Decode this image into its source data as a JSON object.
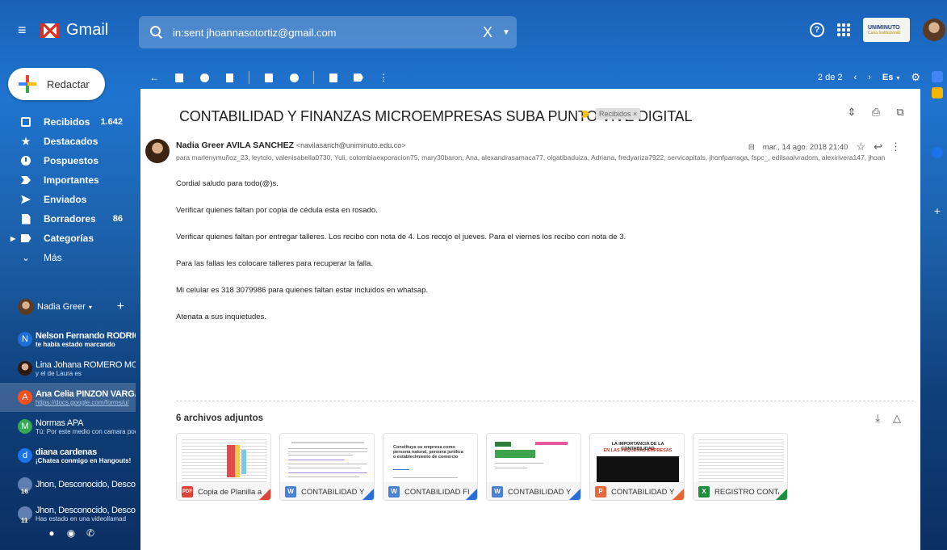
{
  "app": {
    "name": "Gmail"
  },
  "search": {
    "query": "in:sent jhoannasotortiz@gmail.com",
    "clear": "X"
  },
  "org": {
    "name": "UNIMINUTO",
    "sub": "Cuna Institucional"
  },
  "compose": {
    "label": "Redactar"
  },
  "nav": [
    {
      "label": "Recibidos",
      "count": "1.642"
    },
    {
      "label": "Destacados"
    },
    {
      "label": "Pospuestos"
    },
    {
      "label": "Importantes"
    },
    {
      "label": "Enviados"
    },
    {
      "label": "Borradores",
      "count": "86"
    },
    {
      "label": "Categorías"
    },
    {
      "label": "Más"
    }
  ],
  "hangouts": {
    "user": "Nadia Greer"
  },
  "contacts": [
    {
      "initial": "N",
      "color": "#1e6fd9",
      "name": "Nelson Fernando RODRIGUI",
      "sub": "te había estado marcando"
    },
    {
      "initial": "",
      "color": "#4a3a2a",
      "name": "Lina Johana ROMERO MORE",
      "sub": "y el de Laura es"
    },
    {
      "initial": "A",
      "color": "#f4511e",
      "name": "Ana Celia PINZON VARGAS",
      "sub": "https://docs.google.com/forms/u/"
    },
    {
      "initial": "M",
      "color": "#34a853",
      "name": "Normas APA",
      "sub": "Tú: Por este medio con camara podi"
    },
    {
      "initial": "d",
      "color": "#1a73e8",
      "name": "diana cardenas",
      "sub": "¡Chatea conmigo en Hangouts!"
    },
    {
      "initial": "",
      "color": "#5f7fb4",
      "name": "Jhon, Desconocido, Desconoc",
      "sub": "",
      "num": "16"
    },
    {
      "initial": "",
      "color": "#5f7fb4",
      "name": "Jhon, Desconocido, Desconoc",
      "sub": "Has estado en una videollamad",
      "num": "11"
    }
  ],
  "toolbar": {
    "pager": "2 de 2",
    "lang": "Es"
  },
  "email": {
    "subject": "CONTABILIDAD Y FINANZAS MICROEMPRESAS SUBA PUNTO VIVE DIGITAL",
    "label": "Recibidos ×",
    "sender_name": "Nadia Greer AVILA SANCHEZ",
    "sender_email": "<navilasanch@uniminuto.edu.co>",
    "date": "mar., 14 ago. 2018 21:40",
    "recipients": "para marlenymuñoz_23, leytolo, valenisabella0730, Yuli, colombiaexporacion75, mary30baron, Ana, alexandrasamaca77, olgatibaduiza, Adriana, fredyariza7922, servicapitals, jhonfparraga, fspc_, edilsaalvradom, alexirivera147, jhoan",
    "body": [
      "Cordial saludo para todo(@)s.",
      "Verificar quienes faltan por copia de cédula  esta en rosado.",
      "Verificar quienes faltan por entregar talleres. Los recibo con nota de 4. Los recojo el jueves. Para el viernes los recibo con nota de 3.",
      "Para las fallas les colocare talleres para recuperar la falla.",
      "Mi celular es 318 3079986 para quienes faltan estar incluidos en whatsap.",
      "Atenata a sus inquietudes."
    ]
  },
  "attachments": {
    "title": "6 archivos adjuntos",
    "items": [
      {
        "type": "PDF",
        "color": "#db4437",
        "corner": "#db4437",
        "name": "Copia de Planilla a..."
      },
      {
        "type": "W",
        "color": "#4a7fd4",
        "corner": "#2b6fd6",
        "name": "CONTABILIDAD Y F..."
      },
      {
        "type": "W",
        "color": "#4a7fd4",
        "corner": "#2b6fd6",
        "name": "CONTABILIDAD FI...",
        "preview_title": "Constituya su empresa como persona natural, persona jurídica o establecimiento de comercio"
      },
      {
        "type": "W",
        "color": "#4a7fd4",
        "corner": "#2b6fd6",
        "name": "CONTABILIDAD Y F..."
      },
      {
        "type": "P",
        "color": "#e8673a",
        "corner": "#e8673a",
        "name": "CONTABILIDAD Y F...",
        "preview_title": "LA IMPORTANCIA DE LA CONTABILIDAD",
        "preview_sub": "EN LAS PEQUEÑAS EMPRESAS"
      },
      {
        "type": "X",
        "color": "#1e8e3e",
        "corner": "#1e8e3e",
        "name": "REGISTRO CONTA..."
      }
    ]
  }
}
